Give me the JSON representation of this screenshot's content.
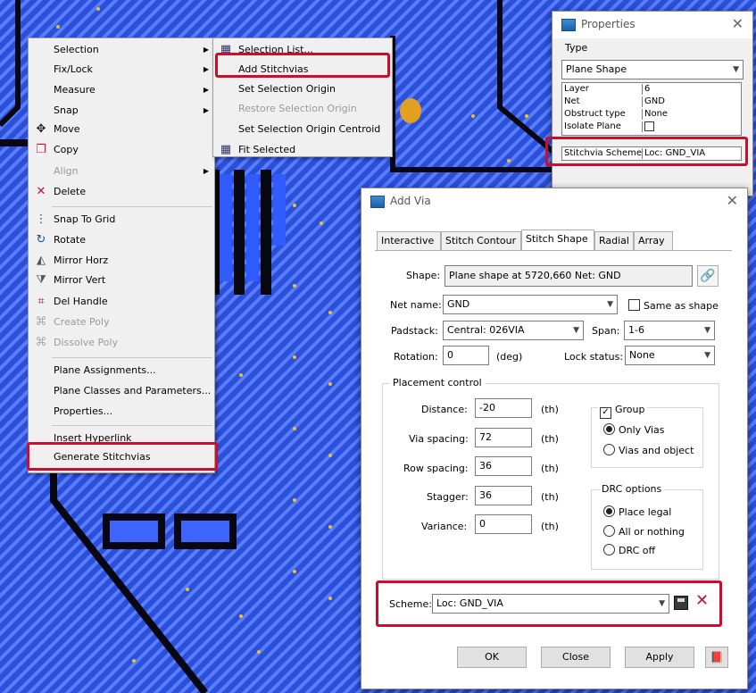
{
  "context_menu": {
    "items": [
      {
        "label": "Selection",
        "submenu": true
      },
      {
        "label": "Fix/Lock",
        "submenu": true
      },
      {
        "label": "Measure",
        "submenu": true
      },
      {
        "label": "Snap",
        "submenu": true
      },
      {
        "label": "Move",
        "icon": "move-icon"
      },
      {
        "label": "Copy",
        "icon": "copy-icon"
      },
      {
        "label": "Align",
        "submenu": true,
        "disabled": true
      },
      {
        "label": "Delete",
        "icon": "delete-icon"
      },
      {
        "label": "Snap To Grid",
        "icon": "snap-grid-icon"
      },
      {
        "label": "Rotate",
        "icon": "rotate-icon"
      },
      {
        "label": "Mirror Horz",
        "icon": "mirror-horz-icon"
      },
      {
        "label": "Mirror Vert",
        "icon": "mirror-vert-icon"
      },
      {
        "label": "Del Handle",
        "icon": "del-handle-icon"
      },
      {
        "label": "Create Poly",
        "icon": "create-poly-icon",
        "disabled": true
      },
      {
        "label": "Dissolve Poly",
        "icon": "dissolve-poly-icon",
        "disabled": true
      },
      {
        "label": "Plane Assignments..."
      },
      {
        "label": "Plane Classes and Parameters..."
      },
      {
        "label": "Properties..."
      },
      {
        "label": "Insert Hyperlink"
      },
      {
        "label": "Generate Stitchvias"
      }
    ]
  },
  "submenu": {
    "items": [
      {
        "label": "Selection List...",
        "icon": "selection-list-icon"
      },
      {
        "label": "Add Stitchvias"
      },
      {
        "label": "Set Selection Origin"
      },
      {
        "label": "Restore Selection Origin",
        "disabled": true
      },
      {
        "label": "Set Selection Origin Centroid"
      },
      {
        "label": "Fit Selected",
        "icon": "fit-selected-icon"
      }
    ]
  },
  "properties": {
    "title": "Properties",
    "type_label": "Type",
    "type_value": "Plane Shape",
    "rows": [
      {
        "key": "Layer",
        "value": "6"
      },
      {
        "key": "Net",
        "value": "GND"
      },
      {
        "key": "Obstruct type",
        "value": "None"
      },
      {
        "key": "Isolate Plane",
        "value": ""
      }
    ],
    "stitch_key": "Stitchvia Scheme",
    "stitch_value": "Loc: GND_VIA"
  },
  "add_via": {
    "title": "Add Via",
    "tabs": [
      "Interactive",
      "Stitch Contour",
      "Stitch Shape",
      "Radial",
      "Array"
    ],
    "active_tab": 2,
    "shape_label": "Shape:",
    "shape_value": "Plane shape at 5720,660 Net: GND",
    "netname_label": "Net name:",
    "netname_value": "GND",
    "same_as_shape": "Same as shape",
    "padstack_label": "Padstack:",
    "padstack_value": "Central: 026VIA",
    "span_label": "Span:",
    "span_value": "1-6",
    "rotation_label": "Rotation:",
    "rotation_value": "0",
    "rotation_unit": "(deg)",
    "lock_label": "Lock status:",
    "lock_value": "None",
    "placement_title": "Placement control",
    "distance_label": "Distance:",
    "distance_value": "-20",
    "via_spacing_label": "Via spacing:",
    "via_spacing_value": "72",
    "row_spacing_label": "Row spacing:",
    "row_spacing_value": "36",
    "stagger_label": "Stagger:",
    "stagger_value": "36",
    "variance_label": "Variance:",
    "variance_value": "0",
    "unit": "(th)",
    "group_label": "Group",
    "only_vias": "Only Vias",
    "vias_object": "Vias and object",
    "drc_title": "DRC options",
    "place_legal": "Place legal",
    "all_or_nothing": "All or nothing",
    "drc_off": "DRC off",
    "scheme_label": "Scheme:",
    "scheme_value": "Loc: GND_VIA",
    "ok": "OK",
    "close": "Close",
    "apply": "Apply"
  },
  "colors": {
    "highlight": "#c8102e",
    "copper": "#2f5bff"
  }
}
